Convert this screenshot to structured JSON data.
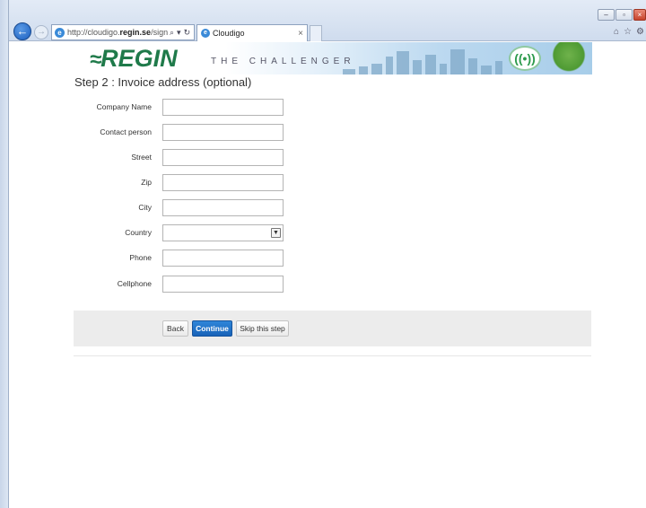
{
  "browser": {
    "url_prefix": "http://cloudigo.",
    "url_domain": "regin.se",
    "url_suffix": "/signups/a",
    "tab_title": "Cloudigo",
    "tab_close": "×"
  },
  "header": {
    "logo_text": "REGIN",
    "tagline": "THE CHALLENGER"
  },
  "page": {
    "step_title": "Step 2 : Invoice address (optional)"
  },
  "form": {
    "fields": [
      {
        "label": "Company Name",
        "value": "",
        "type": "text"
      },
      {
        "label": "Contact person",
        "value": "",
        "type": "text"
      },
      {
        "label": "Street",
        "value": "",
        "type": "text"
      },
      {
        "label": "Zip",
        "value": "",
        "type": "text"
      },
      {
        "label": "City",
        "value": "",
        "type": "text"
      },
      {
        "label": "Country",
        "value": "",
        "type": "select"
      },
      {
        "label": "Phone",
        "value": "",
        "type": "text"
      },
      {
        "label": "Cellphone",
        "value": "",
        "type": "text"
      }
    ]
  },
  "actions": {
    "back_label": "Back",
    "continue_label": "Continue",
    "skip_label": "Skip this step"
  },
  "colors": {
    "brand_green": "#1f7a4a",
    "primary_button": "#1862b8",
    "button_bar_bg": "#ececec"
  }
}
